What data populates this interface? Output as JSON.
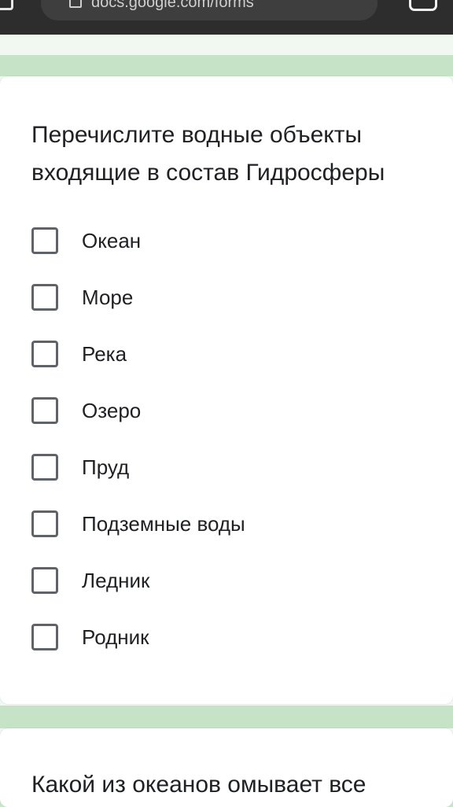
{
  "browser": {
    "url": "docs.google.com/forms"
  },
  "question1": {
    "title": "Перечислите водные объекты входящие в состав Гидросферы",
    "options": [
      {
        "label": "Океан",
        "checked": false
      },
      {
        "label": "Море",
        "checked": false
      },
      {
        "label": "Река",
        "checked": false
      },
      {
        "label": "Озеро",
        "checked": false
      },
      {
        "label": "Пруд",
        "checked": false
      },
      {
        "label": "Подземные воды",
        "checked": false
      },
      {
        "label": "Ледник",
        "checked": false
      },
      {
        "label": "Родник",
        "checked": false
      }
    ]
  },
  "question2": {
    "title": "Какой из океанов омывает все"
  },
  "colors": {
    "accent_strip": "#c6e3c7",
    "text": "#202124",
    "checkbox_border": "#5f6368",
    "toolbar": "#2d2d2d"
  },
  "icons": [
    "lock-icon",
    "tabs-icon"
  ]
}
